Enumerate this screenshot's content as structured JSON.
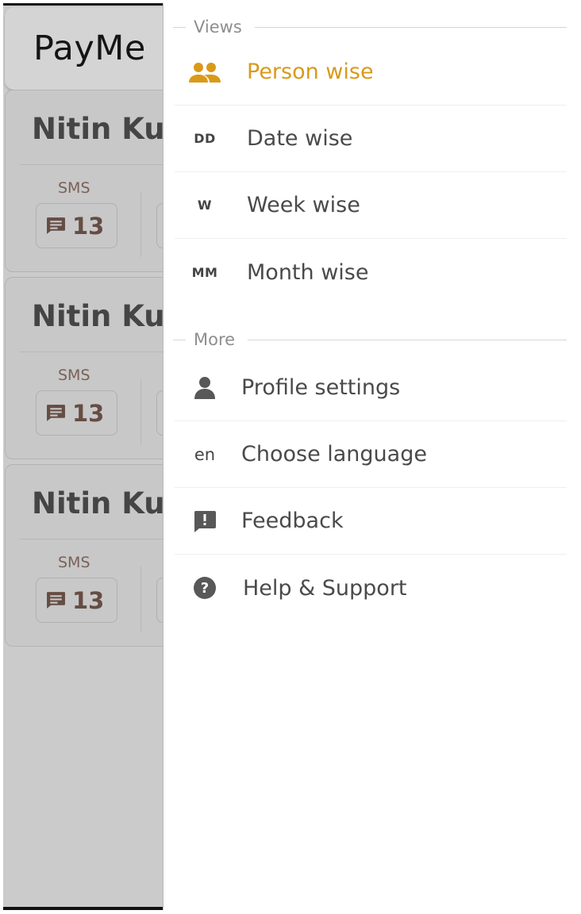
{
  "app": {
    "title": "PayMe",
    "cards": [
      {
        "name": "Nitin Kumar",
        "sms_label": "SMS",
        "sms_count": "13"
      },
      {
        "name": "Nitin Kumar",
        "sms_label": "SMS",
        "sms_count": "13"
      },
      {
        "name": "Nitin Kumar",
        "sms_label": "SMS",
        "sms_count": "13"
      }
    ]
  },
  "drawer": {
    "views_header": "Views",
    "views": [
      {
        "label": "Person wise",
        "icon": "people-icon",
        "active": true
      },
      {
        "label": "Date wise",
        "icon_text": "DD"
      },
      {
        "label": "Week wise",
        "icon_text": "W"
      },
      {
        "label": "Month wise",
        "icon_text": "MM"
      }
    ],
    "more_header": "More",
    "more": [
      {
        "label": "Profile settings",
        "icon": "person-icon"
      },
      {
        "label": "Choose language",
        "icon_text": "en"
      },
      {
        "label": "Feedback",
        "icon": "feedback-icon"
      },
      {
        "label": "Help & Support",
        "icon": "help-icon"
      }
    ]
  },
  "colors": {
    "accent": "#d99a19",
    "overlay": "#cbcbcb",
    "text": "#4a4a4a",
    "section_label": "#8e8e8e"
  }
}
